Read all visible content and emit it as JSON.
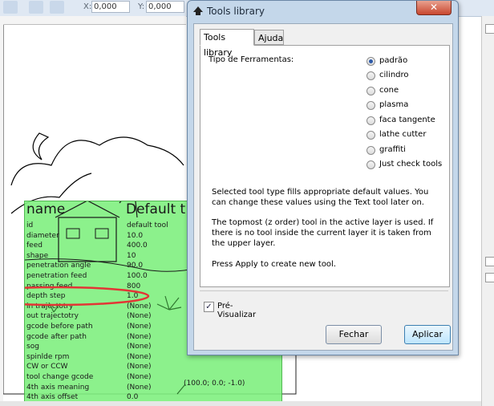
{
  "toolbar": {
    "x_label": "X:",
    "x_value": "0,000",
    "y_label": "Y:",
    "y_value": "0,000"
  },
  "dialog": {
    "title": "Tools library",
    "close_glyph": "✕",
    "tabs": [
      {
        "label": "Tools library"
      },
      {
        "label": "Ajuda"
      }
    ],
    "tool_type_label": "Tipo de Ferramentas:",
    "options": [
      {
        "label": "padrão",
        "selected": true
      },
      {
        "label": "cilindro",
        "selected": false
      },
      {
        "label": "cone",
        "selected": false
      },
      {
        "label": "plasma",
        "selected": false
      },
      {
        "label": "faca tangente",
        "selected": false
      },
      {
        "label": "lathe cutter",
        "selected": false
      },
      {
        "label": "graffiti",
        "selected": false
      },
      {
        "label": "Just check tools",
        "selected": false
      }
    ],
    "info1": "Selected tool type fills appropriate default values. You can change these values using the Text tool later on.",
    "info2": "The topmost (z order) tool in the active layer is used. If there is no tool inside the current layer it is taken from the upper layer.",
    "info3": "Press Apply to create new tool.",
    "preview_label": "Pré-Visualizar",
    "preview_checked": true,
    "close_button": "Fechar",
    "apply_button": "Aplicar"
  },
  "canvas_table": {
    "header_name": "name",
    "header_default": "Default t",
    "rows": [
      {
        "key": "id",
        "value": "default tool"
      },
      {
        "key": "diameter",
        "value": "10.0"
      },
      {
        "key": "feed",
        "value": "400.0"
      },
      {
        "key": "shape",
        "value": "10"
      },
      {
        "key": "penetration angle",
        "value": "90.0"
      },
      {
        "key": "penetration feed",
        "value": "100.0"
      },
      {
        "key": "passing feed",
        "value": "800"
      },
      {
        "key": "depth step",
        "value": "1.0"
      },
      {
        "key": "in trajectotry",
        "value": "(None)"
      },
      {
        "key": "out trajectotry",
        "value": "(None)"
      },
      {
        "key": "gcode before path",
        "value": "(None)"
      },
      {
        "key": "gcode after path",
        "value": "(None)"
      },
      {
        "key": "sog",
        "value": "(None)"
      },
      {
        "key": "spinlde rpm",
        "value": "(None)"
      },
      {
        "key": "CW or CCW",
        "value": "(None)"
      },
      {
        "key": "tool change gcode",
        "value": "(None)"
      },
      {
        "key": "4th axis meaning",
        "value": "(None)"
      },
      {
        "key": "4th axis offset",
        "value": "0.0"
      }
    ],
    "coordinate_note": "(100.0; 0.0; -1.0)"
  },
  "colors": {
    "table_green": "#80f080",
    "highlight_red": "#e02020"
  }
}
